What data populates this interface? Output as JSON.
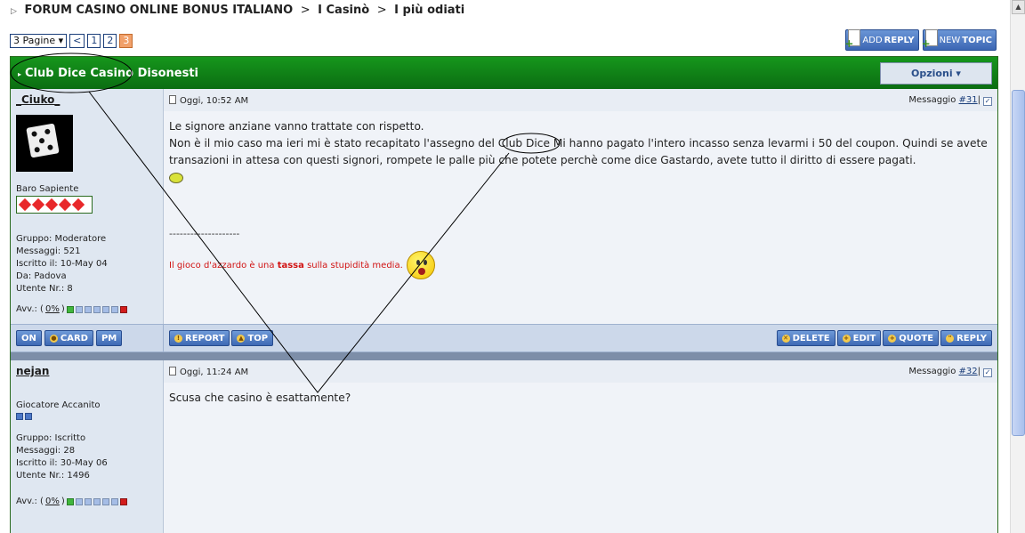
{
  "breadcrumb": {
    "root": "FORUM CASINO ONLINE BONUS ITALIANO",
    "sep": ">",
    "section": "I Casinò",
    "topic": "I più odiati"
  },
  "pagination": {
    "dropdown": "3 Pagine ▾",
    "prev": "<",
    "pages": [
      "1",
      "2",
      "3"
    ]
  },
  "top_buttons": {
    "add_reply_pre": "ADD",
    "add_reply": "REPLY",
    "new_topic_pre": "NEW",
    "new_topic": "TOPIC"
  },
  "thread": {
    "title": "Club Dice Casino Disonesti",
    "options": "Opzioni ▾"
  },
  "posts": [
    {
      "author": "_Ciuko_",
      "rank": "Baro Sapiente",
      "group": "Gruppo: Moderatore",
      "messages": "Messaggi: 521",
      "joined": "Iscritto il: 10-May 04",
      "from": "Da: Padova",
      "user_no": "Utente Nr.: 8",
      "warn_label": "Avv.: (",
      "warn_value": "0%",
      "warn_close": ")",
      "date": "Oggi, 10:52 AM",
      "msg_label": "Messaggio ",
      "msg_num": "#31",
      "msg_pipe": "|",
      "line1": "Le signore anziane vanno trattate con rispetto.",
      "line2a": "Non è il mio caso ma ieri mi è stato recapitato l'assegno del ",
      "line2b": "Club Dice",
      "line2c": " Mi hanno pagato l'intero incasso senza levarmi i 50 del coupon. Quindi se avete transazioni in attesa con questi signori, rompete le palle più che potete perchè come dice Gastardo, avete tutto il diritto di essere pagati.",
      "sig_line": "--------------------",
      "sig_a": "Il gioco d'azzardo è una ",
      "sig_b": "tassa",
      "sig_c": " sulla stupidità media."
    },
    {
      "author": "nejan",
      "rank": "Giocatore Accanito",
      "group": "Gruppo: Iscritto",
      "messages": "Messaggi: 28",
      "joined": "Iscritto il: 30-May 06",
      "user_no": "Utente Nr.: 1496",
      "warn_label": "Avv.: (",
      "warn_value": "0%",
      "warn_close": ")",
      "date": "Oggi, 11:24 AM",
      "msg_label": "Messaggio ",
      "msg_num": "#32",
      "msg_pipe": "|",
      "body": "Scusa che casino è esattamente?"
    }
  ],
  "actions": {
    "on": "ON",
    "card": "CARD",
    "pm": "PM",
    "report": "REPORT",
    "top": "TOP",
    "delete": "DELETE",
    "edit": "EDIT",
    "quote": "QUOTE",
    "reply": "REPLY"
  },
  "colors": {
    "header_green": "#0b6d12",
    "button_blue": "#3e69b4",
    "signature_red": "#d11313"
  }
}
